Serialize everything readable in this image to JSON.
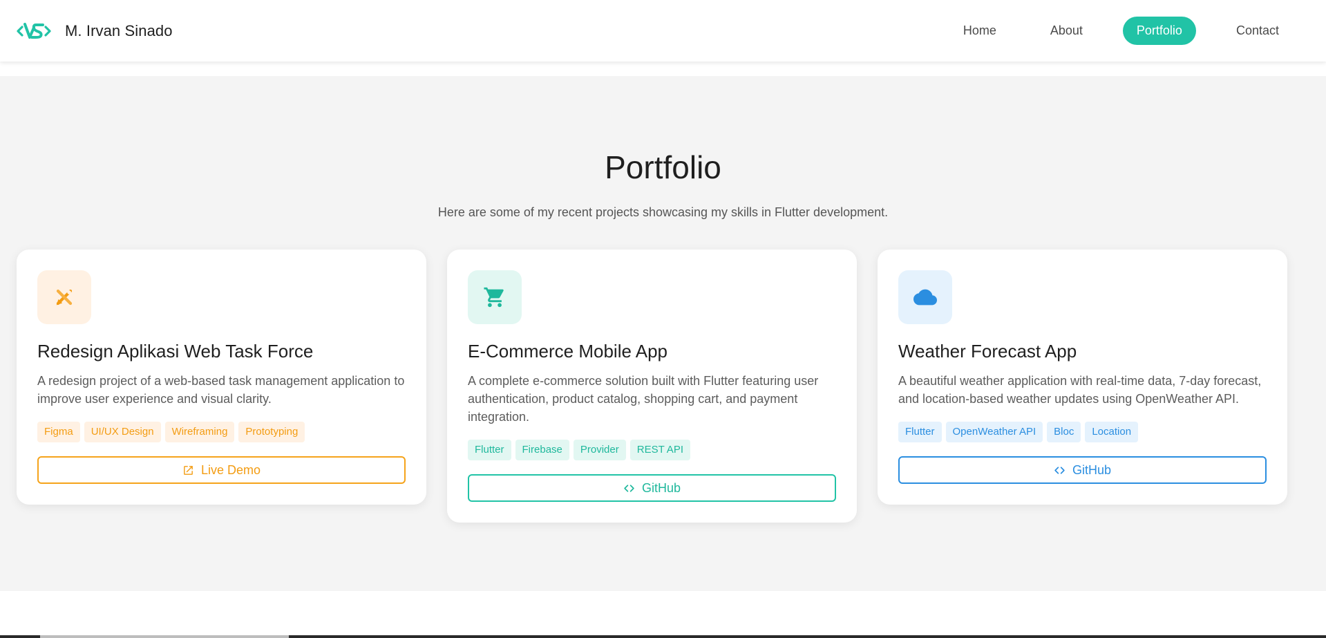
{
  "header": {
    "brand_name": "M. Irvan Sinado",
    "logo_icon": "vs-logo-icon",
    "accent": "#21c3a6",
    "nav": [
      {
        "label": "Home",
        "active": false
      },
      {
        "label": "About",
        "active": false
      },
      {
        "label": "Portfolio",
        "active": true
      },
      {
        "label": "Contact",
        "active": false
      }
    ]
  },
  "portfolio": {
    "title": "Portfolio",
    "subtitle": "Here are some of my recent projects showcasing my skills in Flutter development.",
    "projects": [
      {
        "icon": "design-tools-icon",
        "color": "#f39c12",
        "title": "Redesign Aplikasi Web Task Force",
        "description": "A redesign project of a web-based task management application to improve user experience and visual clarity.",
        "tags": [
          "Figma",
          "UI/UX Design",
          "Wireframing",
          "Prototyping"
        ],
        "button_icon": "external-link-icon",
        "button_label": "Live Demo"
      },
      {
        "icon": "shopping-cart-icon",
        "color": "#21c3a6",
        "title": "E-Commerce Mobile App",
        "description": "A complete e-commerce solution built with Flutter featuring user authentication, product catalog, shopping cart, and payment integration.",
        "tags": [
          "Flutter",
          "Firebase",
          "Provider",
          "REST API"
        ],
        "button_icon": "code-icon",
        "button_label": "GitHub"
      },
      {
        "icon": "cloud-icon",
        "color": "#2b8ee0",
        "title": "Weather Forecast App",
        "description": "A beautiful weather application with real-time data, 7-day forecast, and location-based weather updates using OpenWeather API.",
        "tags": [
          "Flutter",
          "OpenWeather API",
          "Bloc",
          "Location"
        ],
        "button_icon": "code-icon",
        "button_label": "GitHub"
      }
    ]
  }
}
